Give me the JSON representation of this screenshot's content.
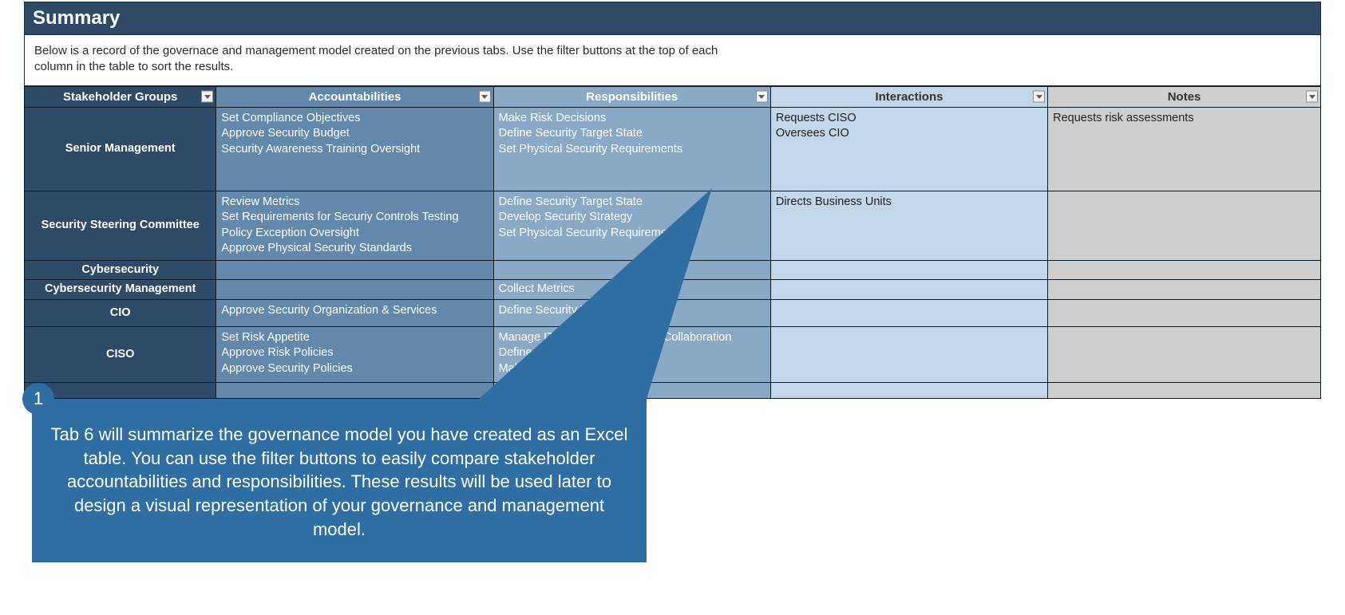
{
  "title": "Summary",
  "intro": "Below is a record of the governace and management model created on the previous tabs. Use the filter buttons at the top of each column in the table to sort the results.",
  "columns": [
    "Stakeholder Groups",
    "Accountabilities",
    "Responsibilities",
    "Interactions",
    "Notes"
  ],
  "rows": [
    {
      "group": "Senior Management",
      "accountabilities": "Set Compliance Objectives\nApprove Security Budget\nSecurity Awareness Training Oversight",
      "responsibilities": "Make Risk Decisions\nDefine Security Target State\nSet Physical Security Requirements",
      "interactions": "Requests CISO\nOversees CIO",
      "notes": "Requests risk assessments",
      "cls": "big"
    },
    {
      "group": "Security Steering Committee",
      "accountabilities": "Review Metrics\nSet Requirements for Securiy Controls Testing\nPolicy Exception Oversight\nApprove Physical Security Standards",
      "responsibilities": "Define Security Target State\nDevelop Security Strategy\nSet Physical Security Requirements",
      "interactions": "Directs Business Units",
      "notes": "",
      "cls": "med"
    },
    {
      "group": "Cybersecurity",
      "accountabilities": "",
      "responsibilities": "",
      "interactions": "",
      "notes": "",
      "cls": "sm"
    },
    {
      "group": "Cybersecurity Management",
      "accountabilities": "",
      "responsibilities": "Collect Metrics",
      "interactions": "",
      "notes": "",
      "cls": "sm"
    },
    {
      "group": "CIO",
      "accountabilities": "Approve Security Organization & Services",
      "responsibilities": "Define Security Target State",
      "interactions": "",
      "notes": "",
      "cls": "mid"
    },
    {
      "group": "CISO",
      "accountabilities": "Set Risk Appetite\nApprove Risk Policies\nApprove Security Policies",
      "responsibilities": "Manage IT-Information Security Collaboration\nDefine Security Target State\nMake Risk Decisions",
      "interactions": "",
      "notes": "",
      "cls": "mid2"
    }
  ],
  "callout": {
    "badge": "1",
    "text": "Tab 6 will summarize the governance model you have created as an Excel table. You can use the filter buttons to easily compare stakeholder accountabilities and responsibilities. These results will be used later to design a visual representation of your governance and management model."
  }
}
